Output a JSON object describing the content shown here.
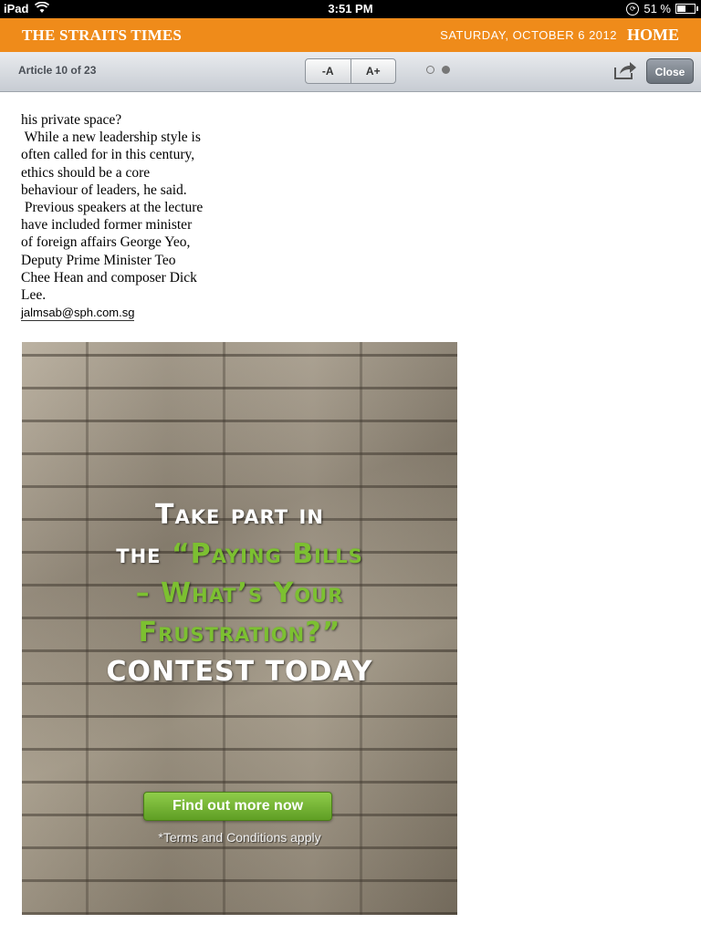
{
  "status_bar": {
    "device": "iPad",
    "time": "3:51 PM",
    "battery": "51 %"
  },
  "masthead": {
    "logo": "THE STRAITS TIMES",
    "date": "SATURDAY, OCTOBER 6 2012",
    "home_label": "HOME"
  },
  "toolbar": {
    "article_counter": "Article 10 of 23",
    "font_decrease": "-A",
    "font_increase": "A+",
    "close_label": "Close",
    "page_dots_total": 2,
    "page_dot_active": 2
  },
  "article": {
    "lines": [
      "his private space?",
      " While a new leadership style is",
      "often called for in this century,",
      "ethics should be a core",
      "behaviour of leaders, he said.",
      " Previous speakers at the lecture",
      "have included former minister",
      "of foreign affairs George Yeo,",
      "Deputy Prime Minister Teo",
      "Chee Hean and composer Dick",
      "Lee."
    ],
    "email": "jalmsab@sph.com.sg"
  },
  "advert": {
    "line1": "Take part in",
    "line2_white": "the ",
    "line2_green": "“Paying Bills",
    "line3": "– What’s Your",
    "line4": "Frustration?”",
    "line5": "contest today",
    "cta": "Find out more now",
    "terms": "*Terms and Conditions apply"
  },
  "colors": {
    "brand_orange": "#ef8b1a",
    "ad_green": "#7cc031"
  }
}
